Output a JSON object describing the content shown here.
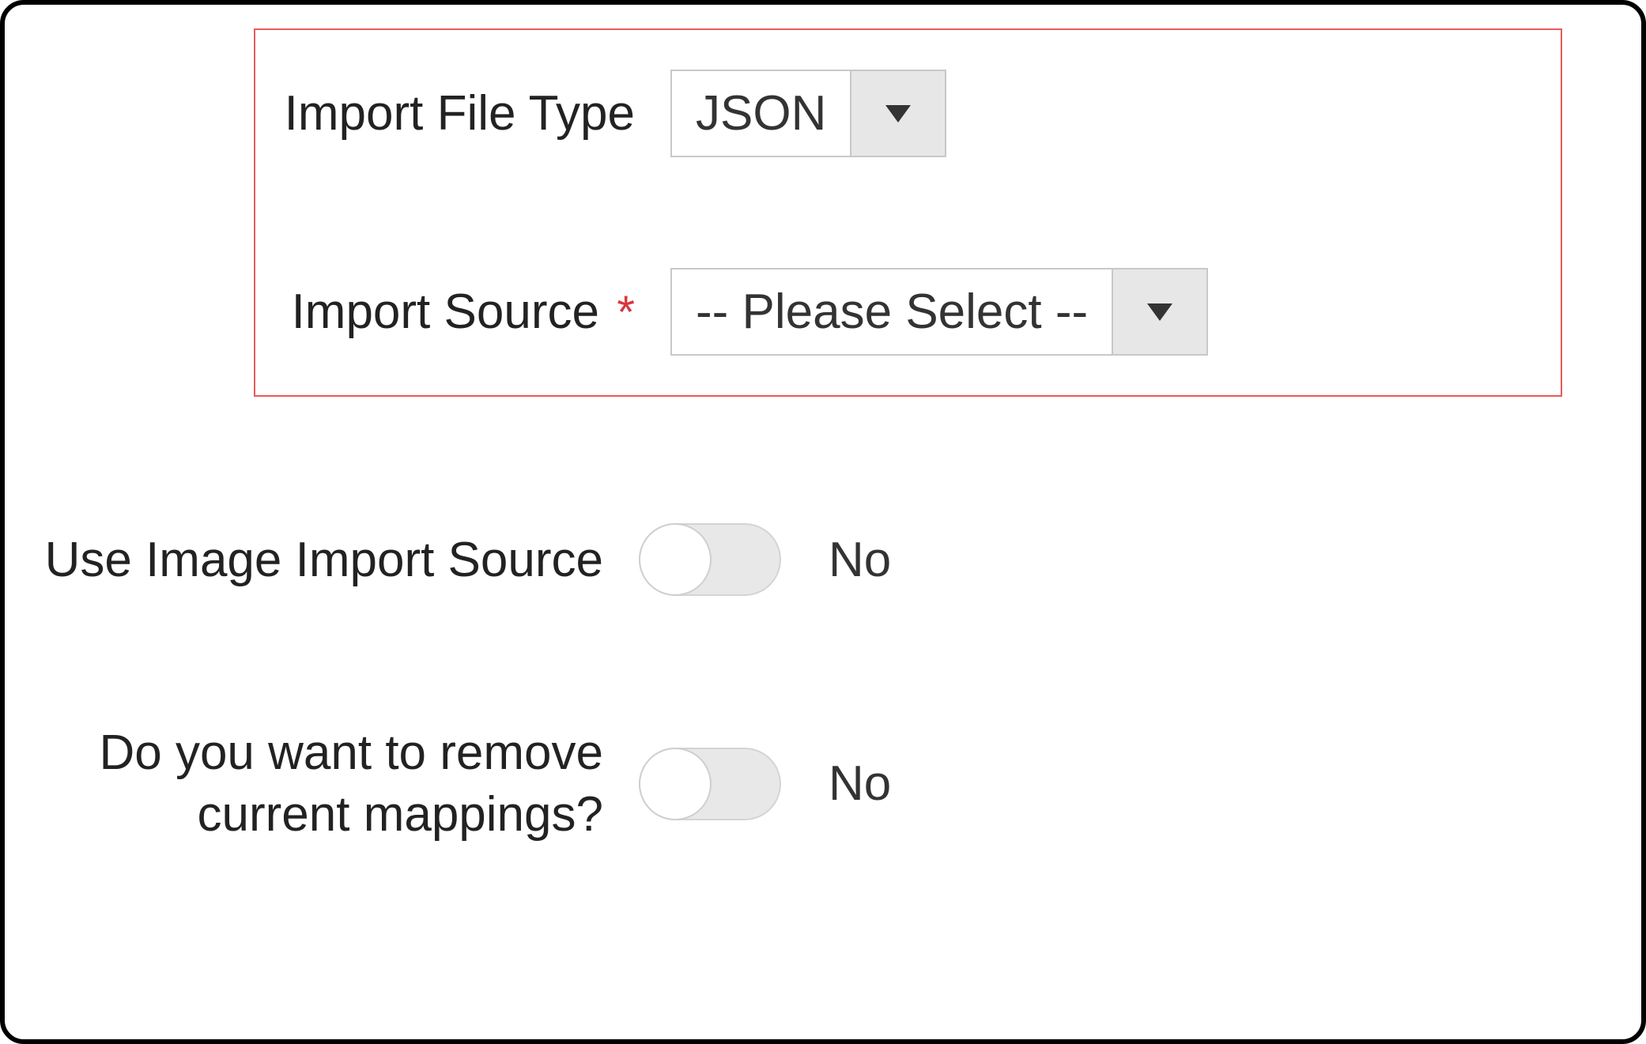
{
  "form": {
    "file_type": {
      "label": "Import File Type",
      "value": "JSON"
    },
    "import_source": {
      "label": "Import Source",
      "required_mark": "*",
      "value": "-- Please Select --"
    },
    "use_image_source": {
      "label": "Use Image Import Source",
      "value": "No"
    },
    "remove_mappings": {
      "label": "Do you want to remove current mappings?",
      "value": "No"
    }
  }
}
